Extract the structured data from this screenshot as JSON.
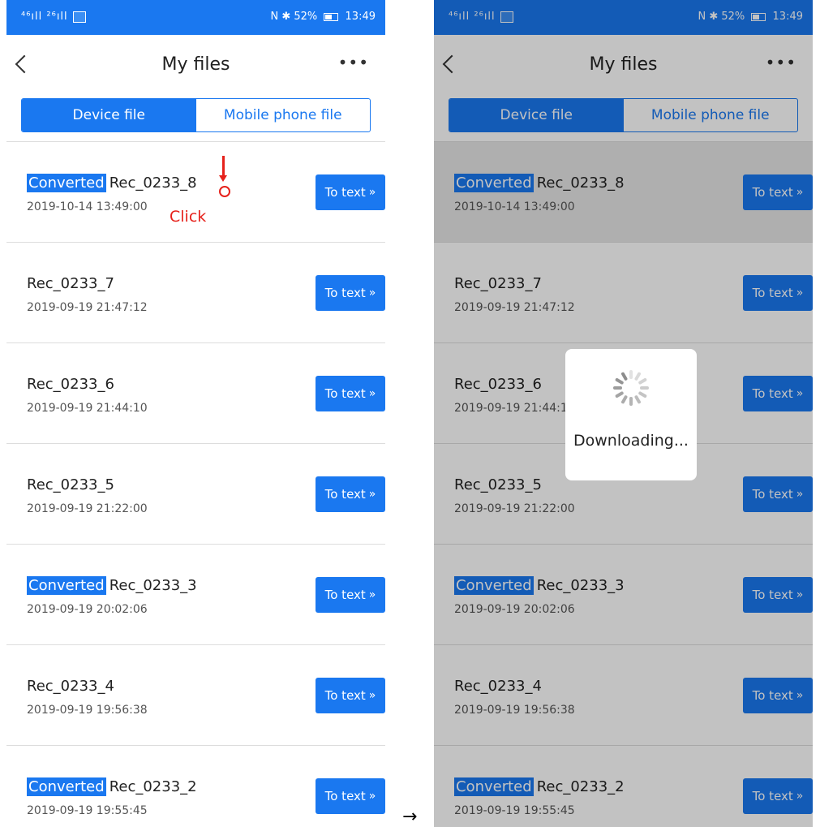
{
  "status_bar": {
    "signal": "⁴⁶ıll ²⁶ıll",
    "right": "N ✱ 52%",
    "time": "13:49"
  },
  "header": {
    "title": "My files",
    "more": "•••"
  },
  "tabs": [
    {
      "label": "Device file"
    },
    {
      "label": "Mobile phone file"
    }
  ],
  "files": [
    {
      "converted": true,
      "badge": "Converted",
      "name": "Rec_0233_8",
      "date": "2019-10-14 13:49:00",
      "button": "To text",
      "chevron": "»"
    },
    {
      "converted": false,
      "badge": "",
      "name": "Rec_0233_7",
      "date": "2019-09-19 21:47:12",
      "button": "To text",
      "chevron": "»"
    },
    {
      "converted": false,
      "badge": "",
      "name": "Rec_0233_6",
      "date": "2019-09-19 21:44:10",
      "button": "To text",
      "chevron": "»"
    },
    {
      "converted": false,
      "badge": "",
      "name": "Rec_0233_5",
      "date": "2019-09-19 21:22:00",
      "button": "To text",
      "chevron": "»"
    },
    {
      "converted": true,
      "badge": "Converted",
      "name": "Rec_0233_3",
      "date": "2019-09-19 20:02:06",
      "button": "To text",
      "chevron": "»"
    },
    {
      "converted": false,
      "badge": "",
      "name": "Rec_0233_4",
      "date": "2019-09-19 19:56:38",
      "button": "To text",
      "chevron": "»"
    },
    {
      "converted": true,
      "badge": "Converted",
      "name": "Rec_0233_2",
      "date": "2019-09-19 19:55:45",
      "button": "To text",
      "chevron": "»"
    }
  ],
  "annotation": {
    "label": "Click"
  },
  "transition_arrow": "→",
  "loading": {
    "text": "Downloading..."
  },
  "colors": {
    "accent": "#1a78f0",
    "annotation": "#e6211b"
  }
}
